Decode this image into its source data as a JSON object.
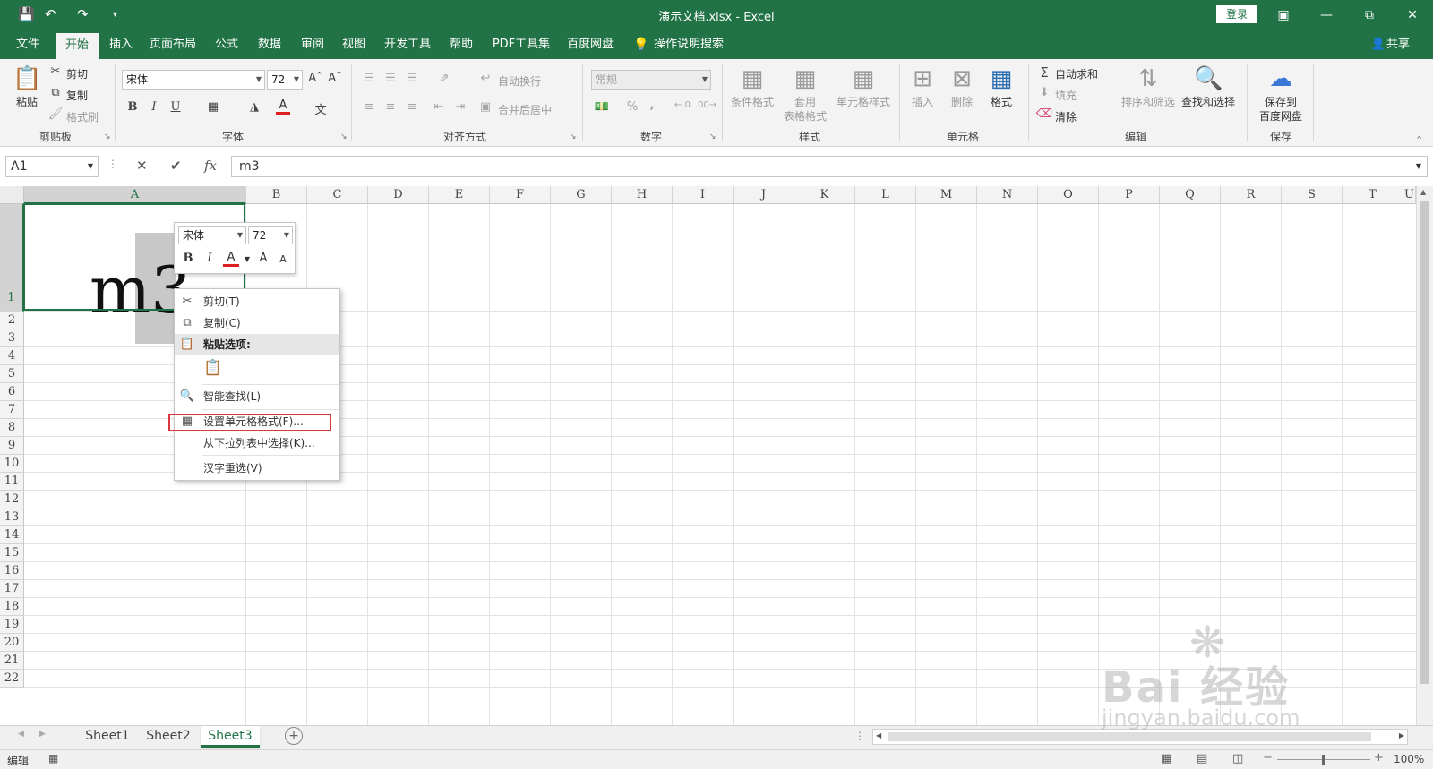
{
  "window": {
    "title": "演示文档.xlsx  -  Excel",
    "login": "登录"
  },
  "tabs": [
    "文件",
    "开始",
    "插入",
    "页面布局",
    "公式",
    "数据",
    "审阅",
    "视图",
    "开发工具",
    "帮助",
    "PDF工具集",
    "百度网盘"
  ],
  "tell_me": "操作说明搜索",
  "share": "共享",
  "ribbon": {
    "clipboard": {
      "label": "剪贴板",
      "paste": "粘贴",
      "cut": "剪切",
      "copy": "复制",
      "format_painter": "格式刷"
    },
    "font": {
      "label": "字体",
      "name": "宋体",
      "size": "72",
      "bold": "B",
      "italic": "I",
      "underline": "U",
      "font_color": "A"
    },
    "align": {
      "label": "对齐方式",
      "wrap": "自动换行",
      "merge": "合并后居中"
    },
    "number": {
      "label": "数字",
      "format": "常规",
      "percent": "%",
      "comma": ","
    },
    "styles": {
      "label": "样式",
      "conditional": "条件格式",
      "table_format_1": "套用",
      "table_format_2": "表格格式",
      "cell_styles": "单元格样式"
    },
    "cells": {
      "label": "单元格",
      "insert": "插入",
      "delete": "删除",
      "format": "格式"
    },
    "editing": {
      "label": "编辑",
      "autosum": "自动求和",
      "fill": "填充",
      "clear": "清除",
      "sort_filter": "排序和筛选",
      "find_select": "查找和选择"
    },
    "save": {
      "label": "保存",
      "save_baidu_1": "保存到",
      "save_baidu_2": "百度网盘"
    }
  },
  "formula_bar": {
    "name_box": "A1",
    "cancel": "✕",
    "enter": "✔",
    "fx": "fx",
    "content": "m3"
  },
  "columns": [
    "A",
    "B",
    "C",
    "D",
    "E",
    "F",
    "G",
    "H",
    "I",
    "J",
    "K",
    "L",
    "M",
    "N",
    "O",
    "P",
    "Q",
    "R",
    "S",
    "T",
    "U"
  ],
  "rows": [
    "1",
    "2",
    "3",
    "4",
    "5",
    "6",
    "7",
    "8",
    "9",
    "10",
    "11",
    "12",
    "13",
    "14",
    "15",
    "16",
    "17",
    "18",
    "19",
    "20",
    "21",
    "22"
  ],
  "cell_a1": {
    "text": "m3"
  },
  "mini_toolbar": {
    "font": "宋体",
    "size": "72",
    "bold": "B",
    "italic": "I",
    "font_color": "A",
    "grow": "A",
    "shrink": "A"
  },
  "context_menu": {
    "cut": "剪切(T)",
    "copy": "复制(C)",
    "paste_options": "粘贴选项:",
    "smart_lookup": "智能查找(L)",
    "format_cells": "设置单元格格式(F)...",
    "pick_from_list": "从下拉列表中选择(K)...",
    "hanzi_reconvert": "汉字重选(V)"
  },
  "sheets": [
    "Sheet1",
    "Sheet2",
    "Sheet3"
  ],
  "active_sheet": "Sheet3",
  "status": {
    "mode": "编辑",
    "zoom": "100%"
  },
  "watermark": {
    "brand": "Bai  经验",
    "url": "jingyan.baidu.com"
  },
  "colors": {
    "excel_green": "#217346",
    "highlight_red": "#d9363e"
  }
}
